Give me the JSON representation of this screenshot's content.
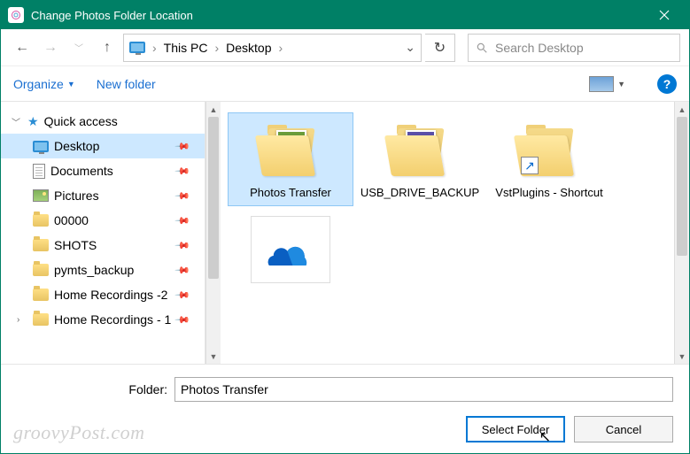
{
  "titlebar": {
    "title": "Change Photos Folder Location"
  },
  "breadcrumb": {
    "root": "This PC",
    "current": "Desktop"
  },
  "search": {
    "placeholder": "Search Desktop"
  },
  "toolbar": {
    "organize": "Organize",
    "new_folder": "New folder"
  },
  "sidebar": {
    "quick_access": "Quick access",
    "items": [
      {
        "label": "Desktop",
        "icon": "monitor",
        "pinned": true,
        "selected": true
      },
      {
        "label": "Documents",
        "icon": "doc",
        "pinned": true
      },
      {
        "label": "Pictures",
        "icon": "pic",
        "pinned": true
      },
      {
        "label": "00000",
        "icon": "folder",
        "pinned": true
      },
      {
        "label": "SHOTS",
        "icon": "folder",
        "pinned": true
      },
      {
        "label": "pymts_backup",
        "icon": "folder",
        "pinned": true
      },
      {
        "label": "Home Recordings -2",
        "icon": "folder",
        "pinned": true
      },
      {
        "label": "Home Recordings - 1",
        "icon": "folder",
        "pinned": true
      }
    ]
  },
  "content": {
    "items": [
      {
        "label": "Photos Transfer",
        "kind": "folder-photo-green",
        "selected": true
      },
      {
        "label": "USB_DRIVE_BACKUP",
        "kind": "folder-photo-purple"
      },
      {
        "label": "VstPlugins - Shortcut",
        "kind": "folder-shortcut"
      },
      {
        "label": "",
        "kind": "cloud"
      }
    ]
  },
  "footer": {
    "folder_label": "Folder:",
    "folder_value": "Photos Transfer",
    "select": "Select Folder",
    "cancel": "Cancel"
  },
  "watermark": "groovyPost.com"
}
